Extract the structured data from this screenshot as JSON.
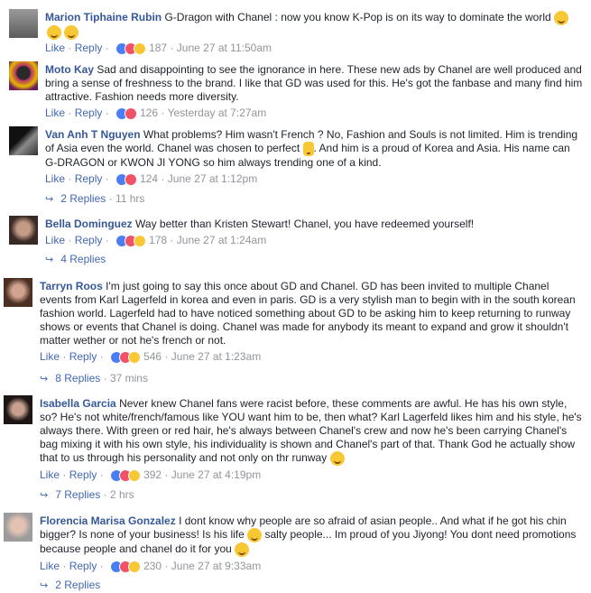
{
  "comments": [
    {
      "author": "Marion Tiphaine Rubin",
      "text": "G-Dragon with Chanel : now you know K-Pop is on its way to dominate the world",
      "like": "Like",
      "reply": "Reply",
      "reactions": [
        "like",
        "love",
        "haha"
      ],
      "count": "187",
      "time": "June 27 at 11:50am",
      "avatar_color": "#7a7a7a"
    },
    {
      "author": "Moto Kay",
      "text": "Sad and disappointing to see the ignorance in here. These new ads by Chanel are well produced and bring a sense of freshness to the brand. I like that GD was used for this. He's got the fanbase and many find him attractive. Fashion needs more diversity.",
      "like": "Like",
      "reply": "Reply",
      "reactions": [
        "like",
        "love"
      ],
      "count": "126",
      "time": "Yesterday at 7:27am",
      "avatar_color": "#b02a6a"
    },
    {
      "author": "Van Anh T Nguyen",
      "text": "What problems? Him wasn't French ? No, Fashion and Souls is not limited. Him is trending of Asia even the world. Chanel was chosen to perfect",
      "text2": ". And him is a proud of Korea and Asia. His name can G-DRAGON or KWON JI YONG so him always trending one of a kind.",
      "like": "Like",
      "reply": "Reply",
      "reactions": [
        "like",
        "love"
      ],
      "count": "124",
      "time": "June 27 at 1:12pm",
      "replies": "2 Replies",
      "replies_ago": "11 hrs",
      "avatar_color": "#3b3b3b"
    },
    {
      "author": "Bella Dominguez",
      "text": "Way better than Kristen Stewart! Chanel, you have redeemed yourself!",
      "like": "Like",
      "reply": "Reply",
      "reactions": [
        "like",
        "love",
        "haha"
      ],
      "count": "178",
      "time": "June 27 at 1:24am",
      "replies": "4 Replies",
      "replies_ago": "",
      "avatar_color": "#4a3b36"
    },
    {
      "author": "Tarryn Roos",
      "text": "I'm just going to say this once about GD and Chanel. GD has been invited to multiple Chanel events from Karl Lagerfeld in korea and even in paris. GD is a very stylish man to begin with in the south korean fashion world. Lagerfeld had to have noticed something about GD to be asking him to keep returning to runway shows or events that Chanel is doing. Chanel was made for anybody its meant to expand and grow it shouldn't matter wether or not he's french or not.",
      "like": "Like",
      "reply": "Reply",
      "reactions": [
        "like",
        "love",
        "wow"
      ],
      "count": "546",
      "time": "June 27 at 1:23am",
      "replies": "8 Replies",
      "replies_ago": "37 mins",
      "avatar_color": "#6b4a3a"
    },
    {
      "author": "Isabella Garcia",
      "text": "Never knew Chanel fans were racist before, these comments are awful. He has his own style, so? He's not white/french/famous like YOU want him to be, then what? Karl Lagerfeld likes him and his style, he's always there. With green or red hair, he's always between Chanel's crew and now he's been carrying Chanel's bag mixing it with his own style, his individuality is shown and Chanel's part of that. Thank God he actually show that to us through his personality and not only on thr runway",
      "like": "Like",
      "reply": "Reply",
      "reactions": [
        "like",
        "love",
        "wow"
      ],
      "count": "392",
      "time": "June 27 at 4:19pm",
      "replies": "7 Replies",
      "replies_ago": "2 hrs",
      "avatar_color": "#2d2320"
    },
    {
      "author": "Florencia Marisa Gonzalez",
      "text": "I dont know why people are so afraid of asian people.. And what if he got his chin bigger? Is none of your business! Is his life",
      "text2": "salty people... Im proud of you Jiyong! You dont need promotions because people and chanel do it for you",
      "like": "Like",
      "reply": "Reply",
      "reactions": [
        "like",
        "love",
        "wow"
      ],
      "count": "230",
      "time": "June 27 at 9:33am",
      "replies": "2 Replies",
      "replies_ago": "",
      "avatar_color": "#8a8a8a"
    }
  ],
  "sep": "·"
}
